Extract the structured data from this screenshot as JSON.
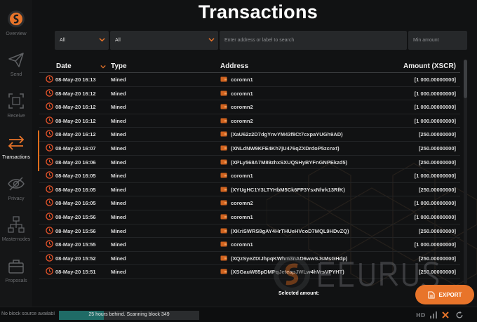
{
  "sidebar": {
    "items": [
      {
        "label": "Overview",
        "icon": "logo-icon"
      },
      {
        "label": "Send",
        "icon": "send-icon"
      },
      {
        "label": "Receive",
        "icon": "receive-icon"
      },
      {
        "label": "Transactions",
        "icon": "transactions-icon",
        "active": true
      },
      {
        "label": "Privacy",
        "icon": "eye-off-icon"
      },
      {
        "label": "Masternodes",
        "icon": "network-icon"
      },
      {
        "label": "Proposals",
        "icon": "proposals-icon"
      }
    ]
  },
  "page": {
    "title": "Transactions"
  },
  "filters": {
    "date": "All",
    "type": "All",
    "address_placeholder": "Enter address or label to search",
    "amount_placeholder": "Min amount"
  },
  "table": {
    "headers": {
      "date": "Date",
      "type": "Type",
      "address": "Address",
      "amount": "Amount (XSCR)"
    },
    "rows": [
      {
        "date": "08-May-20 16:13",
        "type": "Mined",
        "address": "coromn1",
        "amount": "[1 000.00000000]"
      },
      {
        "date": "08-May-20 16:12",
        "type": "Mined",
        "address": "coromn1",
        "amount": "[1 000.00000000]"
      },
      {
        "date": "08-May-20 16:12",
        "type": "Mined",
        "address": "coromn2",
        "amount": "[1 000.00000000]"
      },
      {
        "date": "08-May-20 16:12",
        "type": "Mined",
        "address": "coromn2",
        "amount": "[1 000.00000000]"
      },
      {
        "date": "08-May-20 16:12",
        "type": "Mined",
        "address": "(XaU62z2D7dgYnvYM43f8Ct7cxpaYUGh9AD)",
        "amount": "[250.00000000]"
      },
      {
        "date": "08-May-20 16:07",
        "type": "Mined",
        "address": "(XNLdNW9KFE4Kh7jU476qZXDrdoP5zcnxt)",
        "amount": "[250.00000000]"
      },
      {
        "date": "08-May-20 16:06",
        "type": "Mined",
        "address": "(XPLy568A7M89zhxSXUQSHyBYFnGNPEkzd5)",
        "amount": "[250.00000000]"
      },
      {
        "date": "08-May-20 16:05",
        "type": "Mined",
        "address": "coromn1",
        "amount": "[1 000.00000000]"
      },
      {
        "date": "08-May-20 16:05",
        "type": "Mined",
        "address": "(XYUgHC1Y3LTYHbM5Ck6FP3YsxNhrk13RfK)",
        "amount": "[250.00000000]"
      },
      {
        "date": "08-May-20 16:05",
        "type": "Mined",
        "address": "coromn2",
        "amount": "[1 000.00000000]"
      },
      {
        "date": "08-May-20 15:56",
        "type": "Mined",
        "address": "coromn1",
        "amount": "[1 000.00000000]"
      },
      {
        "date": "08-May-20 15:56",
        "type": "Mined",
        "address": "(XKriSWRS8gAY4HrTHUeHVcoD7MQL9HDvZQ)",
        "amount": "[250.00000000]"
      },
      {
        "date": "08-May-20 15:55",
        "type": "Mined",
        "address": "coromn1",
        "amount": "[1 000.00000000]"
      },
      {
        "date": "08-May-20 15:52",
        "type": "Mined",
        "address": "(XQzSyeZtXJhpqKWhm3nAD6wwSJsMsGHdp)",
        "amount": "[250.00000000]"
      },
      {
        "date": "08-May-20 15:51",
        "type": "Mined",
        "address": "(XSGauW85pDMPqJeteapJWLw4hVrsVPYHT)",
        "amount": "[250.00000000]"
      }
    ]
  },
  "footer": {
    "selected_amount_label": "Selected amount:",
    "export_label": "EXPORT"
  },
  "statusbar": {
    "left_text": "No block source available...",
    "sync_text": "25 hours behind. Scanning block 349",
    "sync_progress": 0.32
  },
  "colors": {
    "accent": "#e8742a",
    "background": "#111213",
    "sync": "#1f6b66"
  }
}
